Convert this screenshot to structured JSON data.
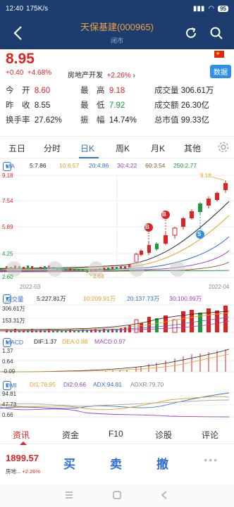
{
  "status_bar": {
    "time": "12:40",
    "speed": "175K/s",
    "battery": "95"
  },
  "nav": {
    "title": "天保基建(000965)",
    "subtitle": "闭市"
  },
  "quote": {
    "price": "8.95",
    "change": "+0.40",
    "change_pct": "+4.68%",
    "sector_name": "房地产开发",
    "sector_change": "+2.26%",
    "data_button": "数据"
  },
  "stats": {
    "open_label": "今　开",
    "open": "8.60",
    "prev_label": "昨　收",
    "prev": "8.55",
    "turnover_label": "换手率",
    "turnover": "27.62%",
    "high_label": "最　高",
    "high": "9.18",
    "low_label": "最　低",
    "low": "7.92",
    "amplitude_label": "振　幅",
    "amplitude": "14.74%",
    "volume_label": "成交量",
    "volume": "306.61万",
    "amount_label": "成交额",
    "amount": "26.30亿",
    "mktcap_label": "总市值",
    "mktcap": "99.33亿"
  },
  "period_tabs": [
    "五日",
    "分时",
    "日K",
    "周K",
    "月K",
    "其他"
  ],
  "ma": {
    "label": "MA",
    "ma5": "5:7.86",
    "ma10": "10:6.57",
    "ma20": "20:4.86",
    "ma30": "30:4.22",
    "ma60": "60:3.54",
    "ma250": "250:2.77"
  },
  "kline_axis": {
    "top": "9.18",
    "y2": "7.54",
    "y3": "5.89",
    "y4": "4.25",
    "bottom": "2.60",
    "max_label": "9.18",
    "min_label": "2.68",
    "date_start": "2022-03",
    "date_end": "2022-04",
    "signal_b1": "B",
    "signal_b2": "B",
    "signal_s": "S"
  },
  "volume_ind": {
    "label": "成交量",
    "v5": "5:227.81万",
    "v10": "10:209.91万",
    "v20": "20:137.73万",
    "v30": "30:100.99万",
    "y_top": "306.61万",
    "y_mid": "153.31万"
  },
  "macd": {
    "label": "MACD",
    "dif": "DIF:1.37",
    "dea": "DEA:0.88",
    "macd": "MACD:0.97",
    "y_top": "1.37",
    "y_mid": "0.64",
    "y_bottom": "-0.09"
  },
  "dmi": {
    "label": "DMI",
    "di1": "DI1:78.95",
    "di2": "DI2:0.66",
    "adx": "ADX:94.81",
    "adxr": "ADXR:79.70",
    "y_top": "94.81",
    "y_mid": "47.73",
    "y_bottom": "0.66"
  },
  "bottom_tabs": [
    "资讯",
    "资金",
    "F10",
    "诊股",
    "评论"
  ],
  "bottom_bar": {
    "index_value": "1899.57",
    "index_name": "房地...",
    "index_change": "+2.26%",
    "buy": "买",
    "sell": "卖",
    "cancel": "撤",
    "more": "•••"
  },
  "colors": {
    "up": "#e02222",
    "down": "#1d9a3c",
    "accent": "#2f6fd8",
    "nav_bg": "#1d3d6e",
    "ma5": "#222222",
    "ma10": "#e8a020",
    "ma20": "#2f6fd8",
    "ma30": "#a040c0",
    "ma60": "#8a5a2a",
    "ma250": "#1d9a3c"
  }
}
